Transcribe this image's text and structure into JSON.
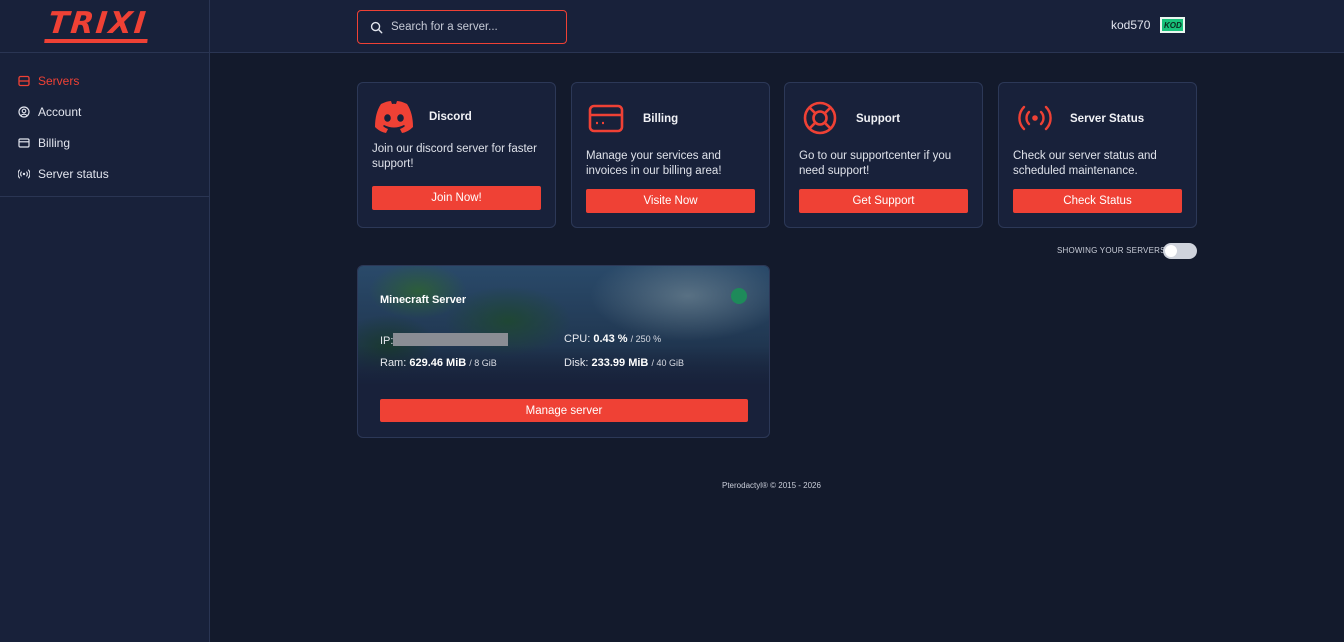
{
  "brand": {
    "logo": "TRIXI",
    "accent": "#ef4135"
  },
  "sidebar": {
    "items": [
      {
        "label": "Servers",
        "icon": "server-icon",
        "active": true
      },
      {
        "label": "Account",
        "icon": "user-circle-icon",
        "active": false
      },
      {
        "label": "Billing",
        "icon": "credit-card-icon",
        "active": false
      },
      {
        "label": "Server status",
        "icon": "broadcast-icon",
        "active": false
      }
    ]
  },
  "header": {
    "search": {
      "placeholder": "Search for a server..."
    },
    "user": {
      "name": "kod570",
      "avatar_text": "KOD"
    }
  },
  "cards": [
    {
      "title": "Discord",
      "icon": "discord-icon",
      "description": "Join our discord server for faster support!",
      "button": "Join Now!"
    },
    {
      "title": "Billing",
      "icon": "credit-card-icon",
      "description": "Manage your services and invoices in our billing area!",
      "button": "Visite Now"
    },
    {
      "title": "Support",
      "icon": "lifebuoy-icon",
      "description": "Go to our supportcenter if you need support!",
      "button": "Get Support"
    },
    {
      "title": "Server Status",
      "icon": "broadcast-icon",
      "description": "Check our server status and scheduled maintenance.",
      "button": "Check Status"
    }
  ],
  "server_filter": {
    "label": "SHOWING YOUR SERVERS",
    "toggled": false
  },
  "server": {
    "name": "Minecraft Server",
    "status_color": "#1e8a5a",
    "ip_label": "IP:",
    "cpu_label": "CPU:",
    "cpu_value": "0.43 %",
    "cpu_limit": "/ 250 %",
    "ram_label": "Ram:",
    "ram_value": "629.46 MiB",
    "ram_limit": "/ 8 GiB",
    "disk_label": "Disk:",
    "disk_value": "233.99 MiB",
    "disk_limit": "/ 40 GiB",
    "button": "Manage server"
  },
  "footer": {
    "text": "Pterodactyl® © 2015 - 2026"
  }
}
